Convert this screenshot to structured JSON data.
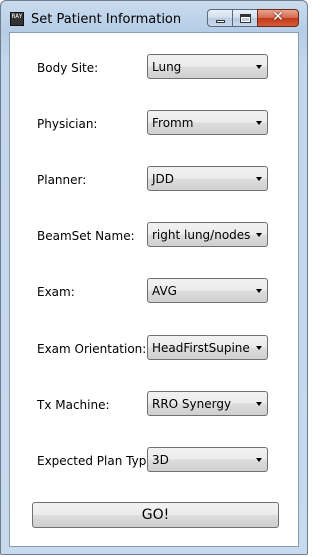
{
  "window": {
    "title": "Set Patient Information",
    "icon_text": "RAY"
  },
  "fields": [
    {
      "label": "Body Site:",
      "value": "Lung"
    },
    {
      "label": "Physician:",
      "value": "Fromm"
    },
    {
      "label": "Planner:",
      "value": "JDD"
    },
    {
      "label": "BeamSet Name:",
      "value": "right lung/nodes"
    },
    {
      "label": "Exam:",
      "value": "AVG"
    },
    {
      "label": "Exam Orientation:",
      "value": "HeadFirstSupine"
    },
    {
      "label": "Tx Machine:",
      "value": "RRO Synergy"
    },
    {
      "label": "Expected Plan Type:",
      "value": "3D"
    }
  ],
  "go_button": {
    "label": "GO!"
  },
  "icons": {
    "minimize": "minimize-icon",
    "maximize": "maximize-icon",
    "close": "close-icon",
    "dropdown": "chevron-down-icon"
  },
  "colors": {
    "titlebar": "#c2d6ec",
    "close_button": "#c2391a",
    "client_background": "#ffffff"
  }
}
